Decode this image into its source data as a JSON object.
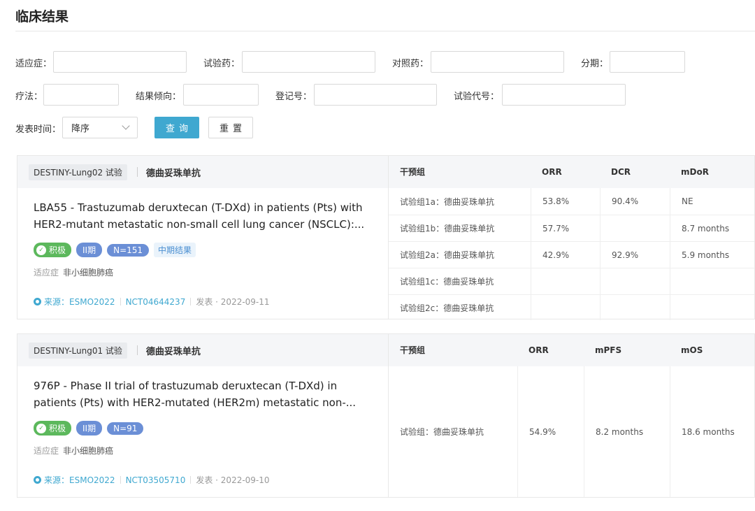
{
  "page_title": "临床结果",
  "filters": {
    "indication_label": "适应症：",
    "test_drug_label": "试验药：",
    "control_drug_label": "对照药：",
    "phase_label": "分期：",
    "therapy_label": "疗法：",
    "result_tendency_label": "结果倾向：",
    "registration_label": "登记号：",
    "trial_code_label": "试验代号：",
    "publish_time_label": "发表时间：",
    "sort_value": "降序",
    "query_button": "查询",
    "reset_button": "重置"
  },
  "cards": [
    {
      "trial": "DESTINY-Lung02 试验",
      "drug": "德曲妥珠单抗",
      "title": "LBA55 - Trastuzumab deruxtecan (T-DXd) in patients (Pts) with HER2-mutant metastatic non-small cell lung cancer (NSCLC):...",
      "tag_positive": "积极",
      "tag_phase": "II期",
      "tag_n": "N=151",
      "tag_stage": "中期结果",
      "indication_label": "适应症",
      "indication": "非小细胞肺癌",
      "source_label": "来源：",
      "source": "ESMO2022",
      "nct": "NCT04644237",
      "published_label": "发表 ·",
      "published": "2022-09-11",
      "columns": [
        "干预组",
        "ORR",
        "DCR",
        "mDoR"
      ],
      "rows": [
        [
          "试验组1a：德曲妥珠单抗",
          "53.8%",
          "90.4%",
          "NE"
        ],
        [
          "试验组1b：德曲妥珠单抗",
          "57.7%",
          "",
          "8.7 months"
        ],
        [
          "试验组2a：德曲妥珠单抗",
          "42.9%",
          "92.9%",
          "5.9 months"
        ],
        [
          "试验组1c：德曲妥珠单抗",
          "",
          "",
          ""
        ],
        [
          "试验组2c：德曲妥珠单抗",
          "",
          "",
          ""
        ]
      ]
    },
    {
      "trial": "DESTINY-Lung01 试验",
      "drug": "德曲妥珠单抗",
      "title": "976P - Phase II trial of trastuzumab deruxtecan (T-DXd) in patients (Pts) with HER2-mutated (HER2m) metastatic non-...",
      "tag_positive": "积极",
      "tag_phase": "II期",
      "tag_n": "N=91",
      "indication_label": "适应症",
      "indication": "非小细胞肺癌",
      "source_label": "来源：",
      "source": "ESMO2022",
      "nct": "NCT03505710",
      "published_label": "发表 ·",
      "published": "2022-09-10",
      "columns": [
        "干预组",
        "ORR",
        "mPFS",
        "mOS"
      ],
      "rows": [
        [
          "试验组：德曲妥珠单抗",
          "54.9%",
          "8.2 months",
          "18.6 months"
        ]
      ]
    }
  ]
}
